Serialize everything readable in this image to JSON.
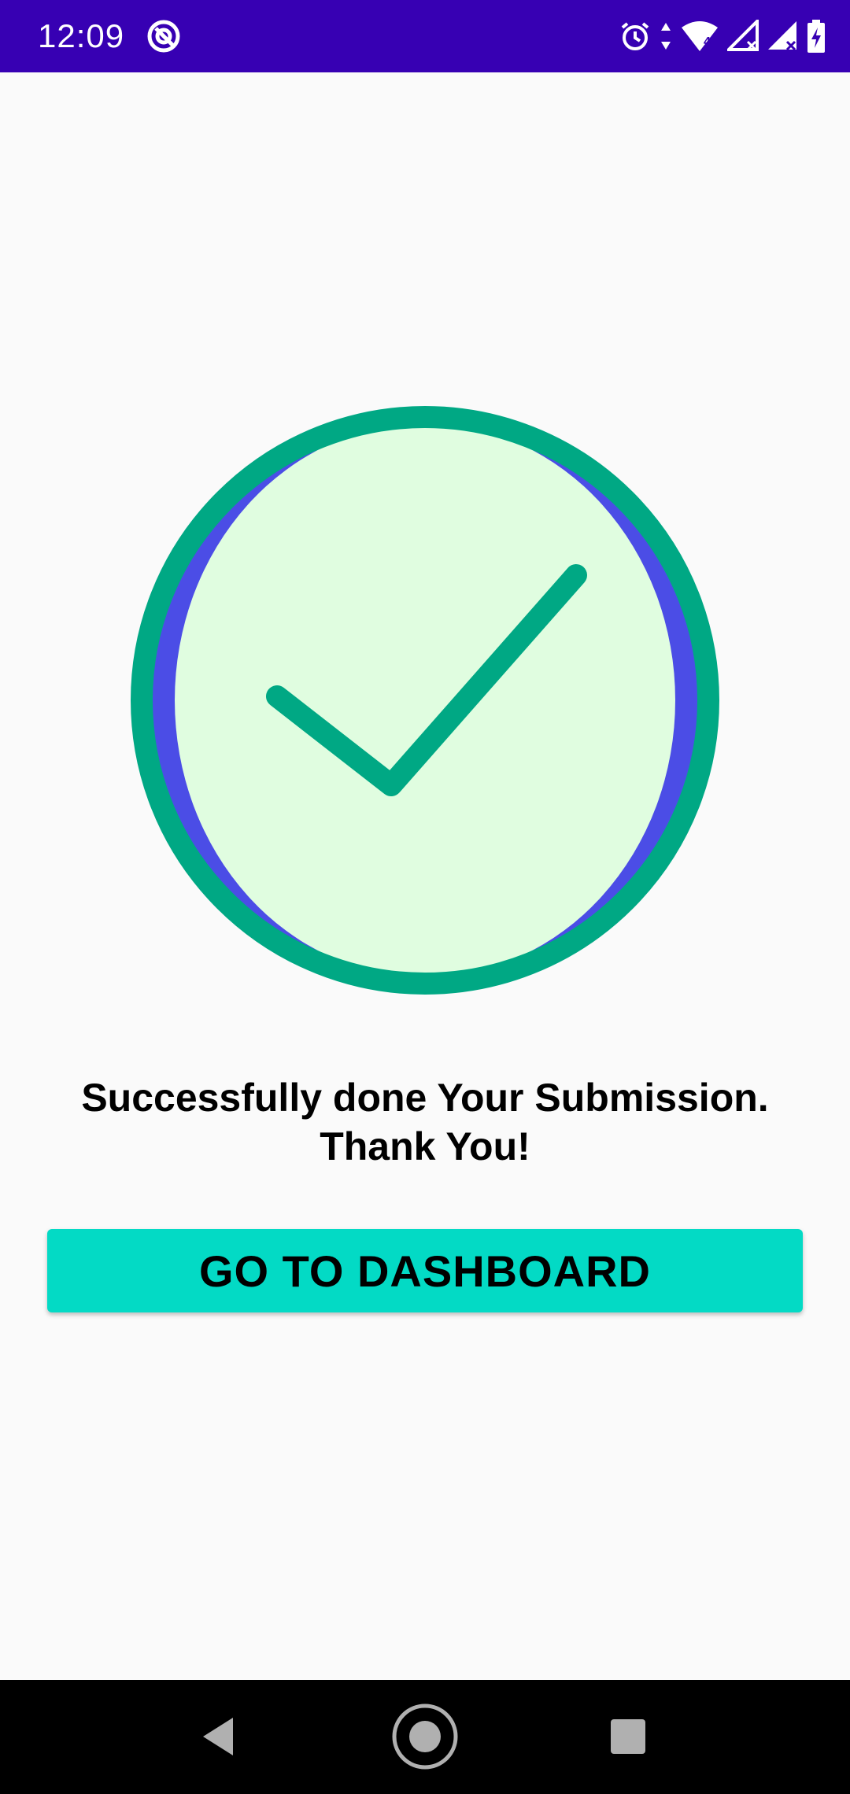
{
  "status_bar": {
    "time": "12:09",
    "icons": [
      "app-notification-icon",
      "alarm-icon",
      "data-arrows-icon",
      "wifi-icon",
      "cell-signal-icon",
      "cell-signal-icon",
      "battery-charging-icon"
    ],
    "wifi_badge": "4",
    "background_color": "#3700b3"
  },
  "main": {
    "icon": "checkmark-circle-icon",
    "message_line1": "Successfully done Your Submission.",
    "message_line2": "Thank You!",
    "button_label": "GO TO DASHBOARD"
  },
  "colors": {
    "accent": "#03dac5",
    "ring": "#00a884",
    "circle_fill": "#e0fde0",
    "circle_shadow": "#4b4de6"
  },
  "nav_bar": {
    "icons": [
      "back-icon",
      "home-icon",
      "recents-icon"
    ]
  }
}
